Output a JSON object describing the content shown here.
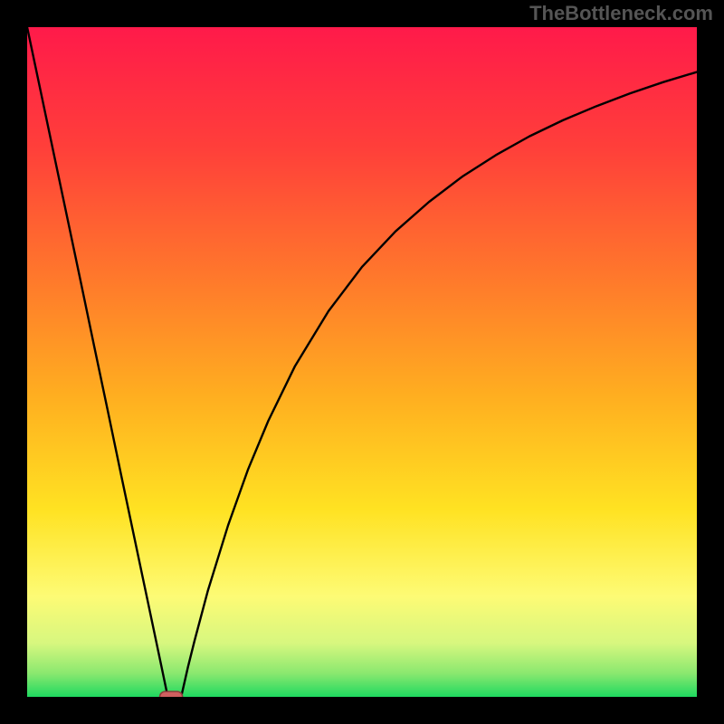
{
  "watermark": "TheBottleneck.com",
  "chart_data": {
    "type": "line",
    "title": "",
    "xlabel": "",
    "ylabel": "",
    "xlim": [
      0,
      100
    ],
    "ylim": [
      0,
      100
    ],
    "x": [
      0,
      2,
      4,
      6,
      8,
      10,
      12,
      14,
      16,
      18,
      20,
      21,
      22,
      23,
      24,
      25,
      27,
      30,
      33,
      36,
      40,
      45,
      50,
      55,
      60,
      65,
      70,
      75,
      80,
      85,
      90,
      95,
      100
    ],
    "y": [
      100,
      90.5,
      81,
      71.5,
      62,
      52.4,
      42.9,
      33.3,
      23.8,
      14.3,
      4.8,
      0,
      0,
      0,
      4.4,
      8.4,
      15.9,
      25.6,
      34,
      41.2,
      49.4,
      57.6,
      64.2,
      69.5,
      73.9,
      77.7,
      80.9,
      83.7,
      86.1,
      88.2,
      90.1,
      91.8,
      93.3
    ],
    "marker": {
      "x": 21.5,
      "y": 0,
      "shape": "pill",
      "width": 3.4,
      "height": 1.6,
      "fill": "#cf6060",
      "stroke": "#8e3c3c"
    },
    "background": {
      "type": "vertical-gradient",
      "stops": [
        {
          "pos": 0.0,
          "color": "#ff1a4a"
        },
        {
          "pos": 0.18,
          "color": "#ff3f3a"
        },
        {
          "pos": 0.38,
          "color": "#ff7a2b"
        },
        {
          "pos": 0.55,
          "color": "#ffae20"
        },
        {
          "pos": 0.72,
          "color": "#ffe222"
        },
        {
          "pos": 0.85,
          "color": "#fdfb75"
        },
        {
          "pos": 0.92,
          "color": "#d7f77f"
        },
        {
          "pos": 0.965,
          "color": "#8ae86f"
        },
        {
          "pos": 1.0,
          "color": "#1fd960"
        }
      ]
    },
    "axes_visible": false,
    "grid": false,
    "legend": false
  }
}
